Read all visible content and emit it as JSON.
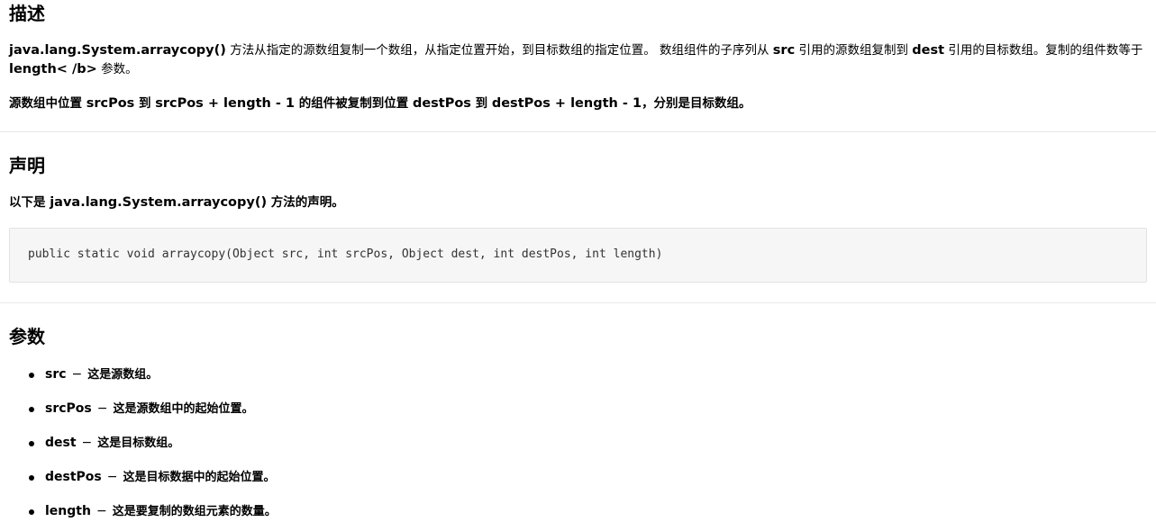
{
  "sections": {
    "description": {
      "title": "描述",
      "p1": {
        "method": "java.lang.System.arraycopy()",
        "t1": " 方法从指定的源数组复制一个数组，从指定位置开始，到目标数组的指定位置。 数组组件的子序列从 ",
        "src": "src",
        "t2": " 引用的源数组复制到 ",
        "dest": "dest",
        "t3": " 引用的目标数组。复制的组件数等于 ",
        "length": "length< /b>",
        "t4": " 参数。"
      },
      "p2": {
        "t1": "源数组中位置 ",
        "srcPos": "srcPos",
        "t2": " 到 ",
        "expr1": "srcPos + length - 1",
        "t3": " 的组件被复制到位置 ",
        "destPos": "destPos",
        "t4": " 到 ",
        "expr2": "destPos + length - 1",
        "t5": "，分别是目标数组。"
      }
    },
    "declaration": {
      "title": "声明",
      "intro_pre": "以下是 ",
      "intro_method": "java.lang.System.arraycopy()",
      "intro_post": " 方法的声明。",
      "code": "public static void arraycopy(Object src, int srcPos, Object dest, int destPos, int length)"
    },
    "parameters": {
      "title": "参数",
      "dash": "−",
      "items": [
        {
          "name": "src",
          "desc": "这是源数组。"
        },
        {
          "name": "srcPos",
          "desc": "这是源数组中的起始位置。"
        },
        {
          "name": "dest",
          "desc": "这是目标数组。"
        },
        {
          "name": "destPos",
          "desc": "这是目标数据中的起始位置。"
        },
        {
          "name": "length",
          "desc": "这是要复制的数组元素的数量。"
        }
      ]
    }
  }
}
